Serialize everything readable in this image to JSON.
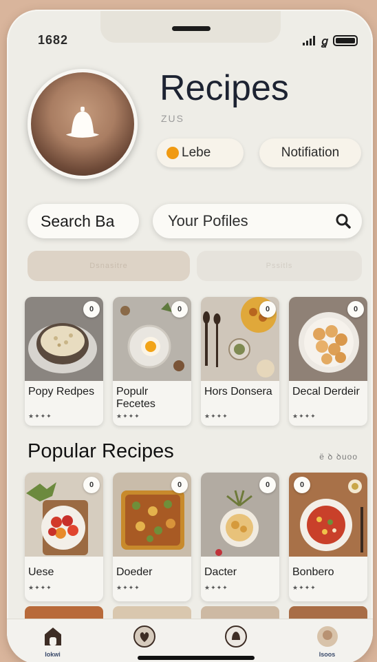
{
  "status_bar": {
    "time": "1682"
  },
  "header": {
    "title": "Recipes",
    "subtitle": "ZUS",
    "pill_left": "Lebe",
    "pill_right": "Notifiation"
  },
  "search": {
    "button_label": "Search Ba",
    "field_value": "Your Pofiles"
  },
  "filters": [
    "Dsnasitre",
    "Pssitls"
  ],
  "row1": [
    {
      "name": "Popy Redpes",
      "badge": "0",
      "stars": "★✦✦✦"
    },
    {
      "name": "Populr Fecetes",
      "badge": "0",
      "stars": "★✦✦✦"
    },
    {
      "name": "Hors Donsera",
      "badge": "0",
      "stars": "★✦✦✦"
    },
    {
      "name": "Decal Derdeir",
      "badge": "0",
      "stars": "★✦✦✦"
    }
  ],
  "section": {
    "title": "Popular Recipes",
    "meta": "ё ꝺ ꝺuoo"
  },
  "row2": [
    {
      "name": "Uese",
      "badge": "0",
      "stars": "★✦✦✦"
    },
    {
      "name": "Doeder",
      "badge": "0",
      "stars": "★✦✦✦"
    },
    {
      "name": "Dacter",
      "badge": "0",
      "stars": "★✦✦✦"
    },
    {
      "name": "Bonbero",
      "badge": "0",
      "stars": "★✦✦✦"
    }
  ],
  "tabs": [
    {
      "label": "Iokwi",
      "icon": "home-icon"
    },
    {
      "label": "",
      "icon": "heart-icon"
    },
    {
      "label": "",
      "icon": "chef-icon"
    },
    {
      "label": "Isoos",
      "icon": "profile-icon"
    }
  ],
  "colors": {
    "accent": "#f09a12",
    "background": "#eeede7"
  }
}
